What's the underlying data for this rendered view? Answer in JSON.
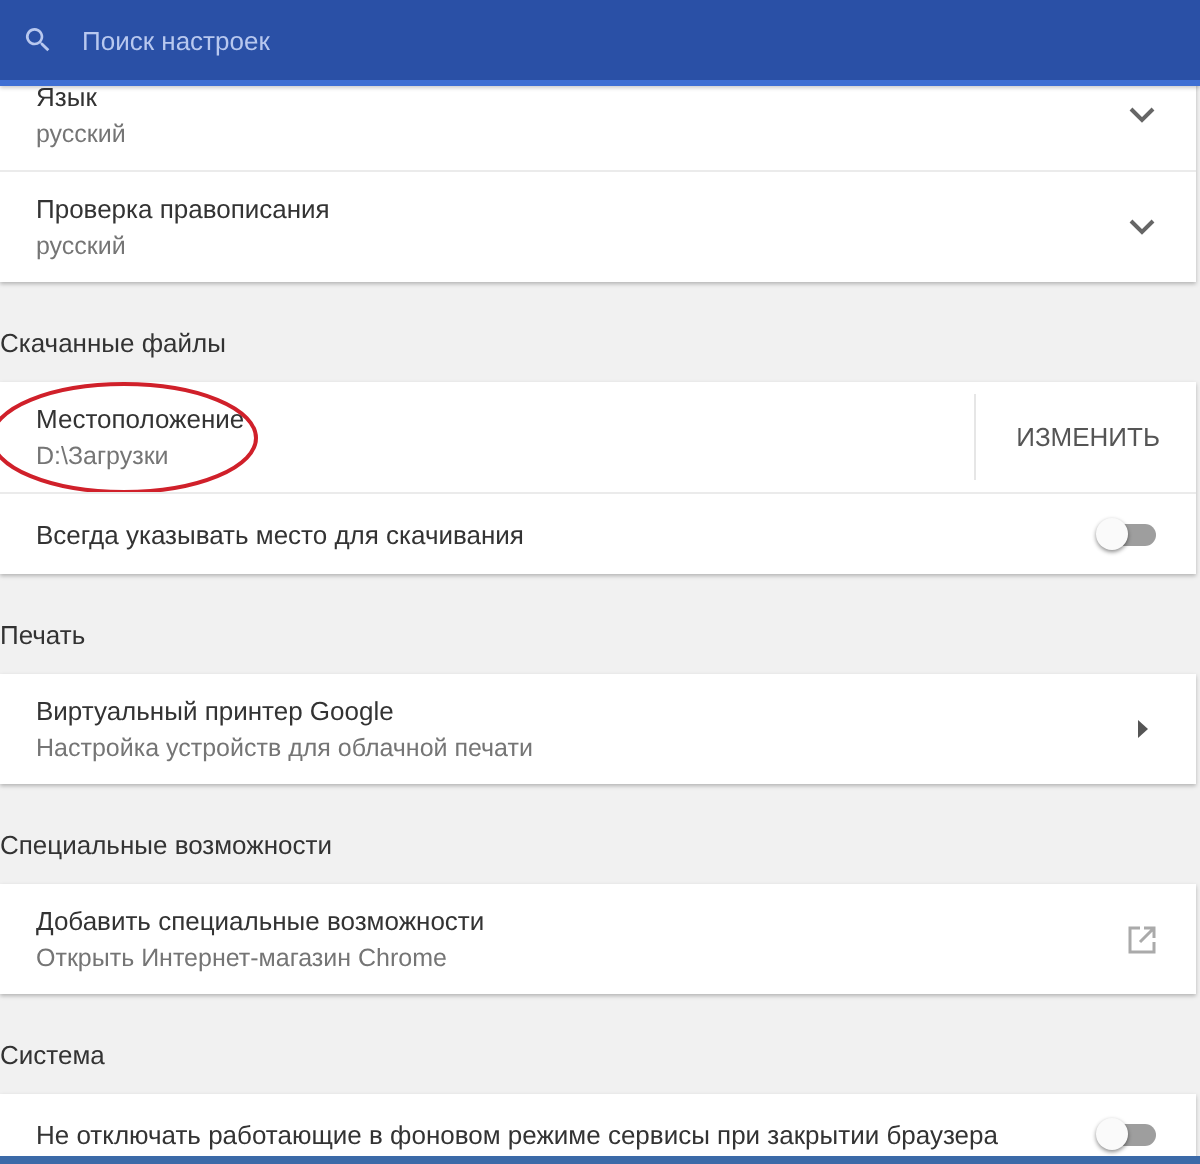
{
  "search": {
    "placeholder": "Поиск настроек"
  },
  "sections": [
    {
      "rows": [
        {
          "kind": "expand",
          "title": "Язык",
          "subtitle": "русский",
          "expanded": false
        },
        {
          "kind": "expand",
          "title": "Проверка правописания",
          "subtitle": "русский",
          "expanded": false
        }
      ]
    },
    {
      "heading": "Скачанные файлы",
      "rows": [
        {
          "kind": "action",
          "title": "Местоположение",
          "subtitle": "D:\\Загрузки",
          "button": "ИЗМЕНИТЬ",
          "annotated": true
        },
        {
          "kind": "toggle",
          "title": "Всегда указывать место для скачивания",
          "on": false
        }
      ]
    },
    {
      "heading": "Печать",
      "rows": [
        {
          "kind": "arrow",
          "title": "Виртуальный принтер Google",
          "subtitle": "Настройка устройств для облачной печати"
        }
      ]
    },
    {
      "heading": "Специальные возможности",
      "rows": [
        {
          "kind": "external",
          "title": "Добавить специальные возможности",
          "subtitle": "Открыть Интернет-магазин Chrome"
        }
      ]
    },
    {
      "heading": "Система",
      "rows": [
        {
          "kind": "toggle",
          "title": "Не отключать работающие в фоновом режиме сервисы при закрытии браузера",
          "on": false
        }
      ]
    }
  ]
}
